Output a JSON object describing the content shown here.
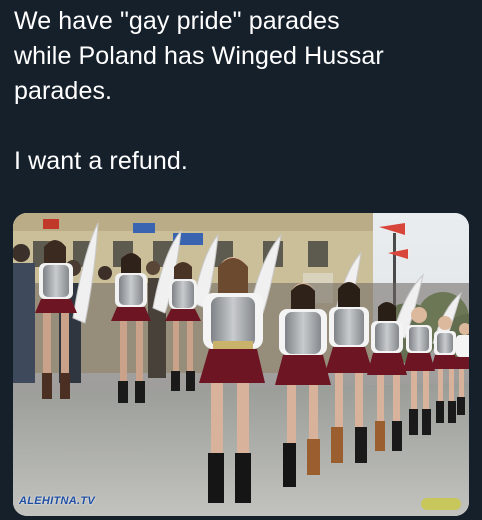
{
  "tweet": {
    "lines": [
      "We have \"gay pride\" parades",
      "while Poland has Winged Hussar",
      "parades.",
      "I want a refund."
    ]
  },
  "media": {
    "watermark": "ALEHITNA.TV",
    "colors": {
      "background": "#15202b",
      "text": "#ffffff",
      "skirt": "#6e1524",
      "armor": "#a9acb0",
      "blouse": "#f2f2f2",
      "boots": "#1a1a1a"
    }
  }
}
